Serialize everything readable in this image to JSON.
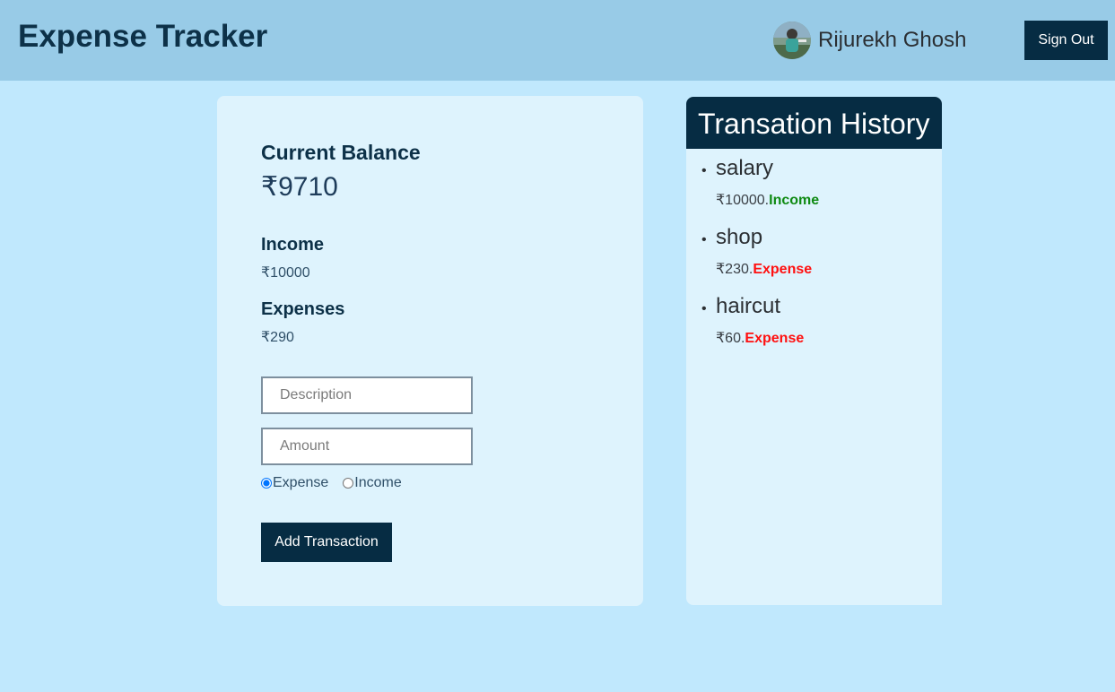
{
  "header": {
    "title": "Expense Tracker",
    "user_name": "Rijurekh Ghosh",
    "sign_out_label": "Sign Out"
  },
  "balance_card": {
    "balance_label": "Current Balance",
    "balance_value": "₹9710",
    "income_label": "Income",
    "income_value": "₹10000",
    "expenses_label": "Expenses",
    "expenses_value": "₹290",
    "description_placeholder": "Description",
    "amount_placeholder": "Amount",
    "type_options": [
      {
        "label": "Expense",
        "selected": true
      },
      {
        "label": "Income",
        "selected": false
      }
    ],
    "add_button_label": "Add Transaction"
  },
  "history": {
    "title": "Transation History",
    "items": [
      {
        "name": "salary",
        "amount": "₹10000.",
        "type": "Income"
      },
      {
        "name": "shop",
        "amount": "₹230.",
        "type": "Expense"
      },
      {
        "name": "haircut",
        "amount": "₹60.",
        "type": "Expense"
      }
    ]
  },
  "colors": {
    "page_bg": "#c0e8fd",
    "header_bg": "#98cbe7",
    "dark_accent": "#062c43",
    "income_color": "#0e8a12",
    "expense_color": "#ff1010"
  },
  "icons": {
    "avatar": "user-avatar-photo"
  }
}
